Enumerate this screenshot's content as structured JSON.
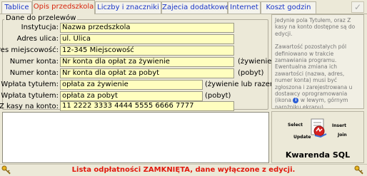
{
  "tabs": [
    {
      "label": "Tablice",
      "active": false
    },
    {
      "label": "Opis przedszkola",
      "active": true
    },
    {
      "label": "Liczby i znaczniki",
      "active": false
    },
    {
      "label": "Zajecia dodatkowe",
      "active": false
    },
    {
      "label": "Internet",
      "active": false
    },
    {
      "label": "Koszt godzin",
      "active": false
    }
  ],
  "toolbar": {
    "check_icon": "check-icon"
  },
  "group_title": "Dane do przelewów",
  "form": {
    "instytucja": {
      "label": "Instytucja:",
      "value": "Nazwa przedszkola"
    },
    "adres_ulica": {
      "label": "Adres ulica:",
      "value": "ul. Ulica"
    },
    "adres_miejscowosc": {
      "label": "Adres miejscowość:",
      "value": "12-345 Miejscowość"
    },
    "numer_konta_1": {
      "label": "Numer konta:",
      "value": "Nr konta dla opłat za żywienie",
      "suffix": "(żywienie)"
    },
    "numer_konta_2": {
      "label": "Numer konta:",
      "value": "Nr konta dla opłat za pobyt",
      "suffix": "(pobyt)"
    },
    "wplata_1": {
      "label": "Wpłata tytułem:",
      "value": "opłata za żywienie",
      "suffix": "(żywienie lub razem)"
    },
    "wplata_2": {
      "label": "Wpłata tytułem:",
      "value": "opłata za pobyt",
      "suffix": "(pobyt)"
    },
    "z_kasy": {
      "label": "Z kasy na konto:",
      "value": "11 2222 3333 4444 5555 6666 7777"
    }
  },
  "info": {
    "paragraph1": "Jedynie pola Tytułem, oraz Z kasy na konto dostępne są do edycji.",
    "paragraph2_before": "Zawartość pozostałych pól definiowano w trakcie zamawiania programu. Ewentualna zmiana ich zawartości (nazwa, adres, numer konta) musi być zgłoszona i zarejestrowana u dostawcy oprogramowania (ikona",
    "paragraph2_after": "w lewym, górnym narożniku ekranu)."
  },
  "logo": {
    "words": {
      "select": "Select",
      "insert": "Insert",
      "join": "Join",
      "update": "Update"
    },
    "title": "Kwarenda SQL"
  },
  "status": {
    "text": "Lista odpłatności ZAMKNIĘTA, dane wyłączone z edycji."
  },
  "colors": {
    "field_bg": "#fffebf",
    "status_red": "#e0180c",
    "tab_blue": "#1a36c8",
    "tab_active_red": "#d8240c"
  }
}
